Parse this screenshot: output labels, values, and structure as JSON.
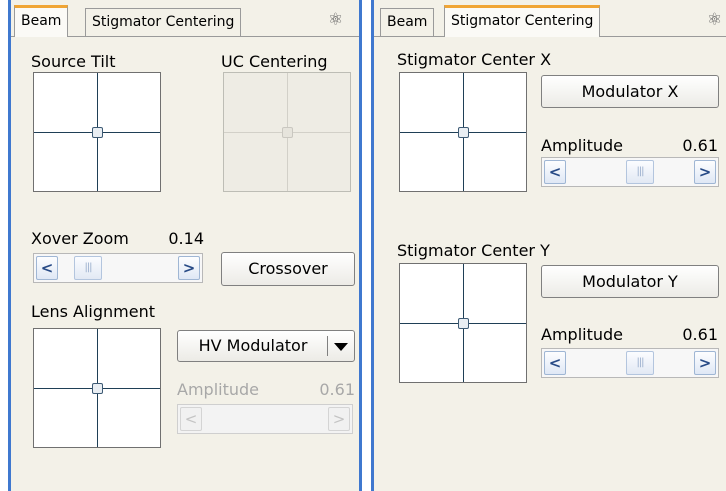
{
  "left_panel": {
    "tabs": [
      {
        "label": "Beam"
      },
      {
        "label": "Stigmator Centering"
      }
    ],
    "active_tab": "Beam",
    "settings_icon": "atom-icon",
    "source_tilt": {
      "label": "Source Tilt"
    },
    "uc_centering": {
      "label": "UC Centering"
    },
    "xover_zoom": {
      "label": "Xover Zoom",
      "value": "0.14",
      "position": 0.1
    },
    "crossover_button": "Crossover",
    "lens_alignment": {
      "label": "Lens Alignment"
    },
    "modulator_select": {
      "value": "HV Modulator"
    },
    "amplitude": {
      "label": "Amplitude",
      "value": "0.61",
      "enabled": false
    }
  },
  "right_panel": {
    "tabs": [
      {
        "label": "Beam"
      },
      {
        "label": "Stigmator Centering"
      }
    ],
    "active_tab": "Stigmator Centering",
    "settings_icon": "atom-icon",
    "center_x": {
      "label": "Stigmator Center X",
      "button": "Modulator X",
      "amplitude_label": "Amplitude",
      "amplitude_value": "0.61",
      "position": 0.61
    },
    "center_y": {
      "label": "Stigmator Center Y",
      "button": "Modulator Y",
      "amplitude_label": "Amplitude",
      "amplitude_value": "0.61",
      "position": 0.61
    }
  },
  "colors": {
    "accent_border": "#3f78cf",
    "active_tab_marker": "#f0a535",
    "panel_bg": "#f3f1e8"
  }
}
